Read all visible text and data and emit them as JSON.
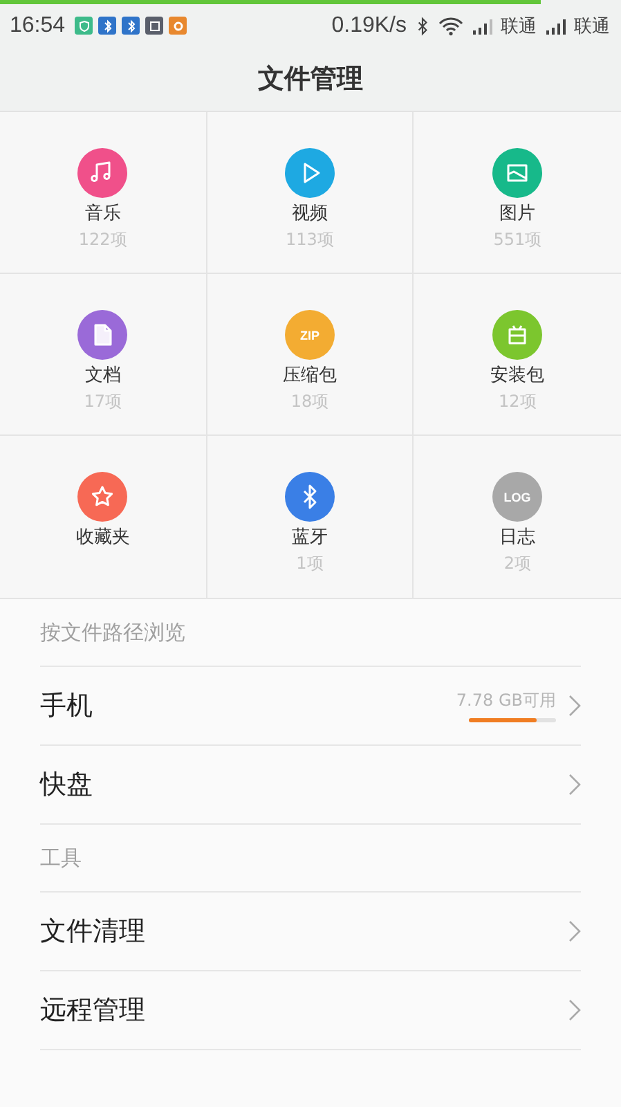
{
  "top_progress": {
    "level": 0.87
  },
  "status_bar": {
    "time": "16:54",
    "notifications": [
      {
        "kind": "shield",
        "color": "#3dbb8a"
      },
      {
        "kind": "bluetooth",
        "color": "#2f74c9"
      },
      {
        "kind": "bluetooth",
        "color": "#2f74c9"
      },
      {
        "kind": "image",
        "color": "#5a5f6b"
      },
      {
        "kind": "ring",
        "color": "#e8882e"
      }
    ],
    "speed": "0.19K/s",
    "carriers": [
      "联通",
      "联通"
    ]
  },
  "title": "文件管理",
  "categories": [
    {
      "label": "音乐",
      "count": "122项",
      "kind": "music",
      "color": "#f0508a"
    },
    {
      "label": "视频",
      "count": "113项",
      "kind": "video",
      "color": "#1ea9e2"
    },
    {
      "label": "图片",
      "count": "551项",
      "kind": "picture",
      "color": "#17b98a"
    },
    {
      "label": "文档",
      "count": "17项",
      "kind": "document",
      "color": "#9a6ad8"
    },
    {
      "label": "压缩包",
      "count": "18项",
      "kind": "zip",
      "color": "#f3ac32",
      "icon_text": "ZIP"
    },
    {
      "label": "安装包",
      "count": "12项",
      "kind": "apk",
      "color": "#7cc62e"
    },
    {
      "label": "收藏夹",
      "kind": "favorite",
      "color": "#f76955"
    },
    {
      "label": "蓝牙",
      "count": "1项",
      "kind": "bluetooth",
      "color": "#3a7fe6"
    },
    {
      "label": "日志",
      "count": "2项",
      "kind": "log",
      "color": "#a8a8a8",
      "icon_text": "LOG"
    }
  ],
  "sections": [
    {
      "title": "按文件路径浏览",
      "rows": [
        {
          "label": "手机",
          "info": "7.78 GB可用",
          "level": 0.78
        },
        {
          "label": "快盘"
        }
      ]
    },
    {
      "title": "工具",
      "rows": [
        {
          "label": "文件清理"
        },
        {
          "label": "远程管理"
        }
      ]
    }
  ]
}
